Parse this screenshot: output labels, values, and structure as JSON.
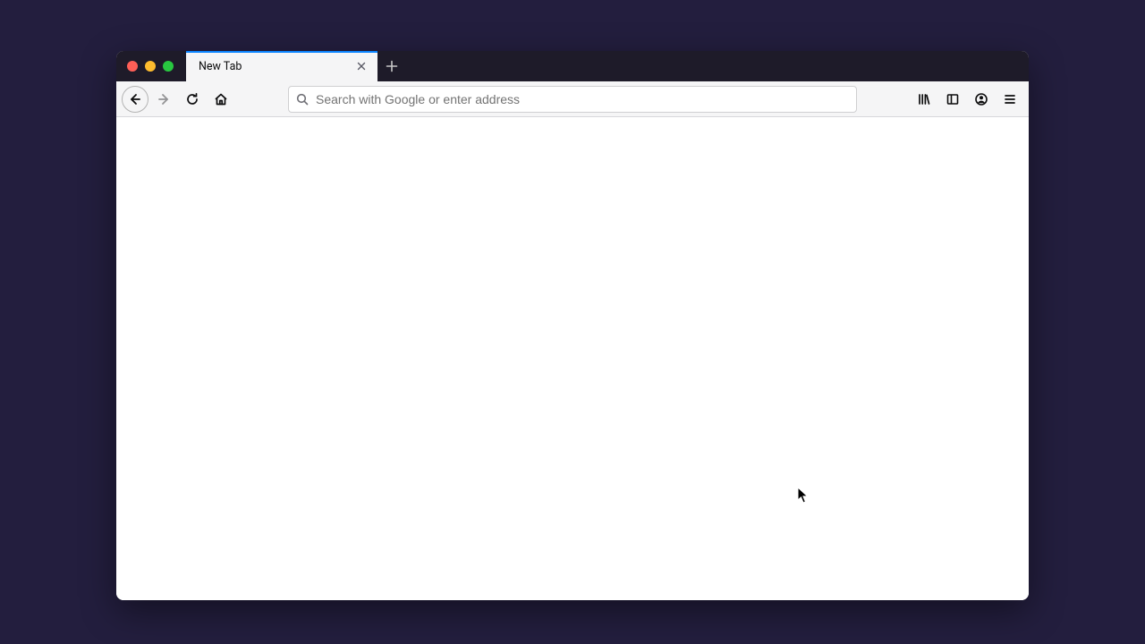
{
  "tabs": [
    {
      "title": "New Tab"
    }
  ],
  "urlbar": {
    "placeholder": "Search with Google or enter address",
    "value": ""
  }
}
